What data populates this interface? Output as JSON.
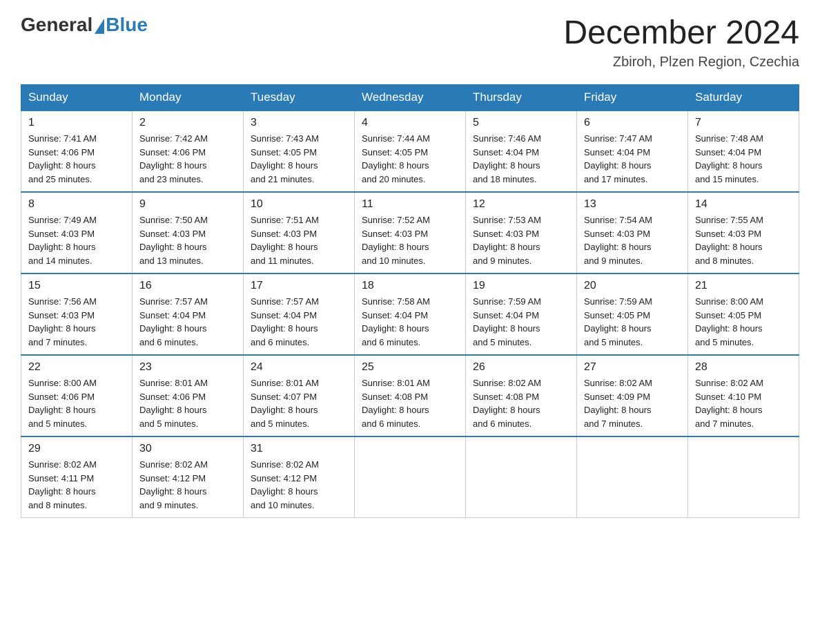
{
  "header": {
    "logo_general": "General",
    "logo_blue": "Blue",
    "month_title": "December 2024",
    "location": "Zbiroh, Plzen Region, Czechia"
  },
  "days_of_week": [
    "Sunday",
    "Monday",
    "Tuesday",
    "Wednesday",
    "Thursday",
    "Friday",
    "Saturday"
  ],
  "weeks": [
    [
      {
        "day": "1",
        "sunrise": "7:41 AM",
        "sunset": "4:06 PM",
        "daylight": "8 hours and 25 minutes."
      },
      {
        "day": "2",
        "sunrise": "7:42 AM",
        "sunset": "4:06 PM",
        "daylight": "8 hours and 23 minutes."
      },
      {
        "day": "3",
        "sunrise": "7:43 AM",
        "sunset": "4:05 PM",
        "daylight": "8 hours and 21 minutes."
      },
      {
        "day": "4",
        "sunrise": "7:44 AM",
        "sunset": "4:05 PM",
        "daylight": "8 hours and 20 minutes."
      },
      {
        "day": "5",
        "sunrise": "7:46 AM",
        "sunset": "4:04 PM",
        "daylight": "8 hours and 18 minutes."
      },
      {
        "day": "6",
        "sunrise": "7:47 AM",
        "sunset": "4:04 PM",
        "daylight": "8 hours and 17 minutes."
      },
      {
        "day": "7",
        "sunrise": "7:48 AM",
        "sunset": "4:04 PM",
        "daylight": "8 hours and 15 minutes."
      }
    ],
    [
      {
        "day": "8",
        "sunrise": "7:49 AM",
        "sunset": "4:03 PM",
        "daylight": "8 hours and 14 minutes."
      },
      {
        "day": "9",
        "sunrise": "7:50 AM",
        "sunset": "4:03 PM",
        "daylight": "8 hours and 13 minutes."
      },
      {
        "day": "10",
        "sunrise": "7:51 AM",
        "sunset": "4:03 PM",
        "daylight": "8 hours and 11 minutes."
      },
      {
        "day": "11",
        "sunrise": "7:52 AM",
        "sunset": "4:03 PM",
        "daylight": "8 hours and 10 minutes."
      },
      {
        "day": "12",
        "sunrise": "7:53 AM",
        "sunset": "4:03 PM",
        "daylight": "8 hours and 9 minutes."
      },
      {
        "day": "13",
        "sunrise": "7:54 AM",
        "sunset": "4:03 PM",
        "daylight": "8 hours and 9 minutes."
      },
      {
        "day": "14",
        "sunrise": "7:55 AM",
        "sunset": "4:03 PM",
        "daylight": "8 hours and 8 minutes."
      }
    ],
    [
      {
        "day": "15",
        "sunrise": "7:56 AM",
        "sunset": "4:03 PM",
        "daylight": "8 hours and 7 minutes."
      },
      {
        "day": "16",
        "sunrise": "7:57 AM",
        "sunset": "4:04 PM",
        "daylight": "8 hours and 6 minutes."
      },
      {
        "day": "17",
        "sunrise": "7:57 AM",
        "sunset": "4:04 PM",
        "daylight": "8 hours and 6 minutes."
      },
      {
        "day": "18",
        "sunrise": "7:58 AM",
        "sunset": "4:04 PM",
        "daylight": "8 hours and 6 minutes."
      },
      {
        "day": "19",
        "sunrise": "7:59 AM",
        "sunset": "4:04 PM",
        "daylight": "8 hours and 5 minutes."
      },
      {
        "day": "20",
        "sunrise": "7:59 AM",
        "sunset": "4:05 PM",
        "daylight": "8 hours and 5 minutes."
      },
      {
        "day": "21",
        "sunrise": "8:00 AM",
        "sunset": "4:05 PM",
        "daylight": "8 hours and 5 minutes."
      }
    ],
    [
      {
        "day": "22",
        "sunrise": "8:00 AM",
        "sunset": "4:06 PM",
        "daylight": "8 hours and 5 minutes."
      },
      {
        "day": "23",
        "sunrise": "8:01 AM",
        "sunset": "4:06 PM",
        "daylight": "8 hours and 5 minutes."
      },
      {
        "day": "24",
        "sunrise": "8:01 AM",
        "sunset": "4:07 PM",
        "daylight": "8 hours and 5 minutes."
      },
      {
        "day": "25",
        "sunrise": "8:01 AM",
        "sunset": "4:08 PM",
        "daylight": "8 hours and 6 minutes."
      },
      {
        "day": "26",
        "sunrise": "8:02 AM",
        "sunset": "4:08 PM",
        "daylight": "8 hours and 6 minutes."
      },
      {
        "day": "27",
        "sunrise": "8:02 AM",
        "sunset": "4:09 PM",
        "daylight": "8 hours and 7 minutes."
      },
      {
        "day": "28",
        "sunrise": "8:02 AM",
        "sunset": "4:10 PM",
        "daylight": "8 hours and 7 minutes."
      }
    ],
    [
      {
        "day": "29",
        "sunrise": "8:02 AM",
        "sunset": "4:11 PM",
        "daylight": "8 hours and 8 minutes."
      },
      {
        "day": "30",
        "sunrise": "8:02 AM",
        "sunset": "4:12 PM",
        "daylight": "8 hours and 9 minutes."
      },
      {
        "day": "31",
        "sunrise": "8:02 AM",
        "sunset": "4:12 PM",
        "daylight": "8 hours and 10 minutes."
      },
      null,
      null,
      null,
      null
    ]
  ]
}
